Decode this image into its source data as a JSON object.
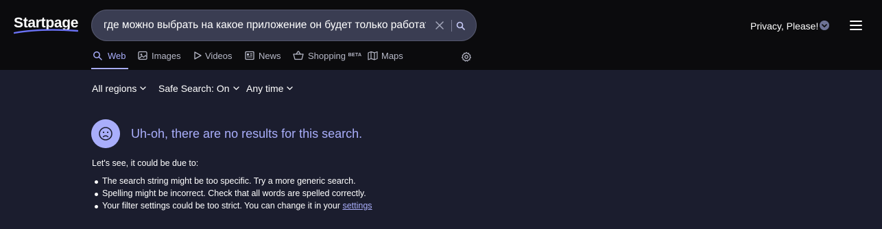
{
  "app": {
    "logo_text": "Startpage"
  },
  "search": {
    "query": "где можно выбрать на какое приложение он будет только работать",
    "clear_icon": "close-icon",
    "submit_icon": "search-icon"
  },
  "account": {
    "label": "Privacy, Please!",
    "chevron_icon": "chevron-down-icon"
  },
  "tabs": [
    {
      "label": "Web",
      "icon": "search-icon",
      "active": true
    },
    {
      "label": "Images",
      "icon": "image-icon",
      "active": false
    },
    {
      "label": "Videos",
      "icon": "play-icon",
      "active": false
    },
    {
      "label": "News",
      "icon": "news-icon",
      "active": false
    },
    {
      "label": "Shopping",
      "badge": "BETA",
      "icon": "shopping-basket-icon",
      "active": false
    },
    {
      "label": "Maps",
      "icon": "map-icon",
      "active": false
    }
  ],
  "filters": {
    "region": "All regions",
    "safe_search": "Safe Search: On",
    "time": "Any time"
  },
  "results": {
    "no_results_title": "Uh-oh, there are no results for this search.",
    "due_to": "Let's see, it could be due to:",
    "reasons": [
      "The search string might be too specific. Try a more generic search.",
      "Spelling might be incorrect. Check that all words are spelled correctly.",
      "Your filter settings could be too strict. You can change it in your"
    ],
    "settings_link": "settings"
  },
  "colors": {
    "header_bg": "#0b0b0d",
    "page_bg": "#1b1d2e",
    "accent": "#a9aefb",
    "searchbox_bg": "#3a3d52"
  }
}
